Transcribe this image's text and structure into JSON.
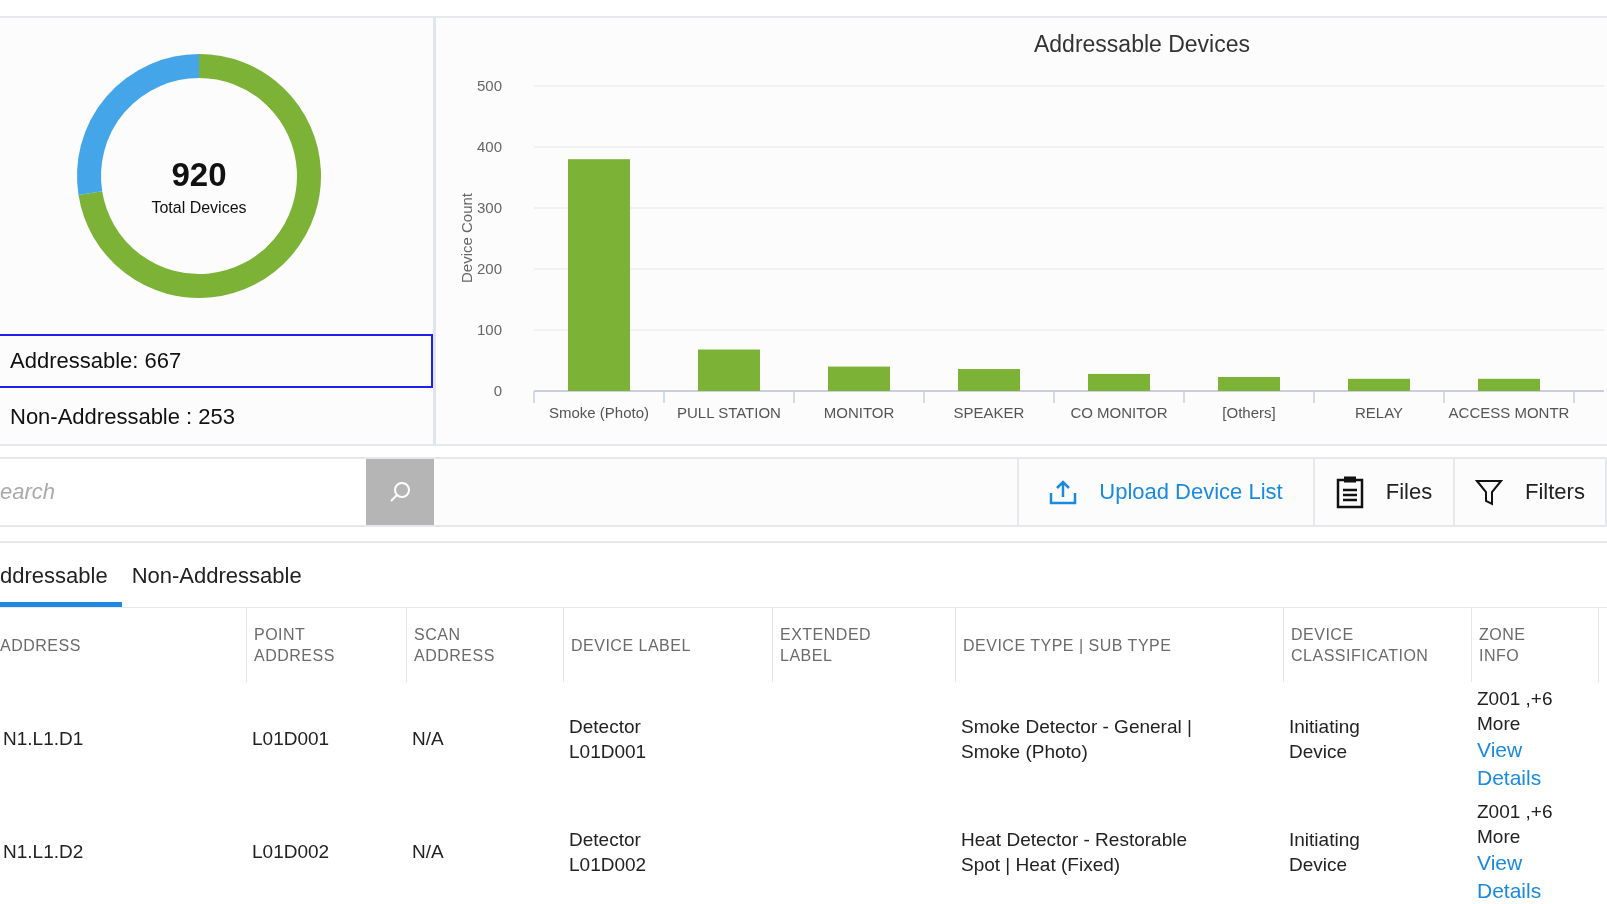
{
  "summary": {
    "total": "920",
    "total_label": "Total Devices",
    "segments": [
      {
        "label": "Addressable:",
        "value": "667",
        "color": "#7cb236",
        "selected": true
      },
      {
        "label": "Non-Addressable :",
        "value": "253",
        "color": "#44a6e8",
        "selected": false
      }
    ]
  },
  "chart": {
    "chart_data": {
      "type": "bar",
      "title": "Addressable Devices",
      "ylabel": "Device Count",
      "categories": [
        "Smoke (Photo)",
        "PULL STATION",
        "MONITOR",
        "SPEAKER",
        "CO MONITOR",
        "[Others]",
        "RELAY",
        "ACCESS MONTR"
      ],
      "series": [
        {
          "color": "#7cb236",
          "values": [
            380,
            68,
            40,
            36,
            28,
            23,
            20,
            20
          ]
        }
      ],
      "ylim": [
        0,
        500
      ],
      "yticks": [
        0,
        100,
        200,
        300,
        400,
        500
      ],
      "grid": true
    }
  },
  "toolbar": {
    "search": {
      "placeholder": "earch"
    },
    "buttons": [
      {
        "label": "Upload Device List",
        "kind": "upload"
      },
      {
        "label": "Files",
        "kind": "files"
      },
      {
        "label": "Filters",
        "kind": "filters"
      }
    ]
  },
  "tabs": [
    {
      "label": "ddressable",
      "selected": true
    },
    {
      "label": "Non-Addressable",
      "selected": false
    }
  ],
  "table": {
    "columns": [
      "ADDRESS",
      "POINT ADDRESS",
      "SCAN ADDRESS",
      "DEVICE LABEL",
      "EXTENDED LABEL",
      "DEVICE TYPE | SUB TYPE",
      "DEVICE CLASSIFICATION",
      "ZONE INFO"
    ],
    "rows": [
      {
        "address": "N1.L1.D1",
        "point_address": "L01D001",
        "scan_address": "N/A",
        "device_label": "Detector L01D001",
        "device_type": "Smoke Detector - General | Smoke (Photo)",
        "classification": "Initiating Device",
        "zone": "Z001 ,+6 More",
        "zone_link": "View Details"
      },
      {
        "address": "N1.L1.D2",
        "point_address": "L01D002",
        "scan_address": "N/A",
        "device_label": "Detector L01D002",
        "device_type": "Heat Detector - Restorable Spot | Heat (Fixed)",
        "classification": "Initiating Device",
        "zone": "Z001 ,+6 More",
        "zone_link": "View Details"
      }
    ]
  }
}
